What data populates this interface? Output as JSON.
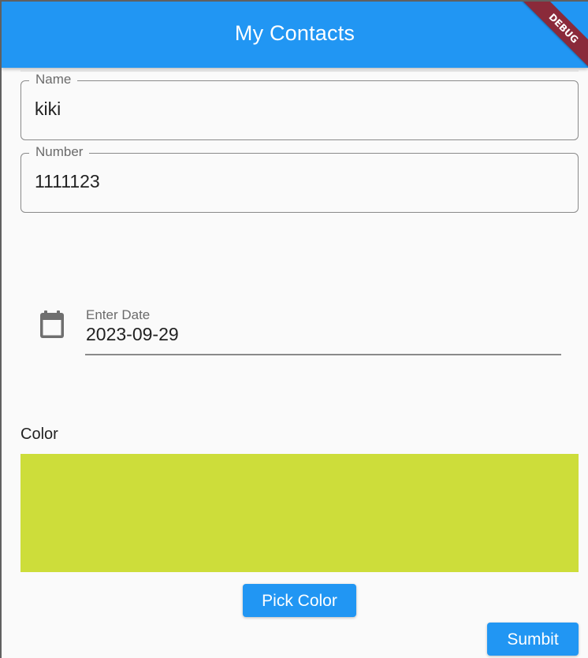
{
  "appbar": {
    "title": "My Contacts",
    "debug_banner": "DEBUG",
    "color": "#2196f3"
  },
  "form": {
    "name_field": {
      "label": "Name",
      "value": "kiki"
    },
    "number_field": {
      "label": "Number",
      "value": "1111123"
    },
    "date_field": {
      "label": "Enter Date",
      "value": "2023-09-29",
      "icon": "calendar-icon"
    },
    "color_section": {
      "label": "Color",
      "selected_color": "#cddd3a"
    },
    "pick_color_button": "Pick Color",
    "submit_button": "Sumbit"
  }
}
